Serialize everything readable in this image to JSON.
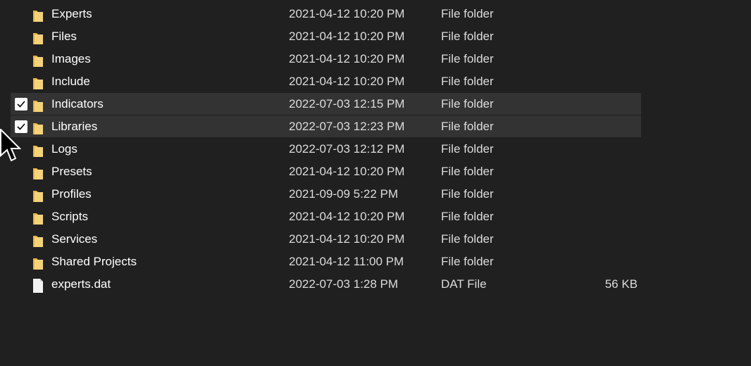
{
  "items": [
    {
      "name": "Experts",
      "date": "2021-04-12 10:20 PM",
      "type": "File folder",
      "size": "",
      "icon": "folder-icon",
      "selected": false
    },
    {
      "name": "Files",
      "date": "2021-04-12 10:20 PM",
      "type": "File folder",
      "size": "",
      "icon": "folder-icon",
      "selected": false
    },
    {
      "name": "Images",
      "date": "2021-04-12 10:20 PM",
      "type": "File folder",
      "size": "",
      "icon": "folder-icon",
      "selected": false
    },
    {
      "name": "Include",
      "date": "2021-04-12 10:20 PM",
      "type": "File folder",
      "size": "",
      "icon": "folder-icon",
      "selected": false
    },
    {
      "name": "Indicators",
      "date": "2022-07-03 12:15 PM",
      "type": "File folder",
      "size": "",
      "icon": "folder-icon",
      "selected": true
    },
    {
      "name": "Libraries",
      "date": "2022-07-03 12:23 PM",
      "type": "File folder",
      "size": "",
      "icon": "folder-icon",
      "selected": true
    },
    {
      "name": "Logs",
      "date": "2022-07-03 12:12 PM",
      "type": "File folder",
      "size": "",
      "icon": "folder-icon",
      "selected": false
    },
    {
      "name": "Presets",
      "date": "2021-04-12 10:20 PM",
      "type": "File folder",
      "size": "",
      "icon": "folder-icon",
      "selected": false
    },
    {
      "name": "Profiles",
      "date": "2021-09-09 5:22 PM",
      "type": "File folder",
      "size": "",
      "icon": "folder-icon",
      "selected": false
    },
    {
      "name": "Scripts",
      "date": "2021-04-12 10:20 PM",
      "type": "File folder",
      "size": "",
      "icon": "folder-icon",
      "selected": false
    },
    {
      "name": "Services",
      "date": "2021-04-12 10:20 PM",
      "type": "File folder",
      "size": "",
      "icon": "folder-icon",
      "selected": false
    },
    {
      "name": "Shared Projects",
      "date": "2021-04-12 11:00 PM",
      "type": "File folder",
      "size": "",
      "icon": "folder-icon",
      "selected": false
    },
    {
      "name": "experts.dat",
      "date": "2022-07-03 1:28 PM",
      "type": "DAT File",
      "size": "56 KB",
      "icon": "file-icon",
      "selected": false
    }
  ],
  "colors": {
    "background": "#202020",
    "selected_row": "#333333",
    "folder": "#f3c64f"
  }
}
